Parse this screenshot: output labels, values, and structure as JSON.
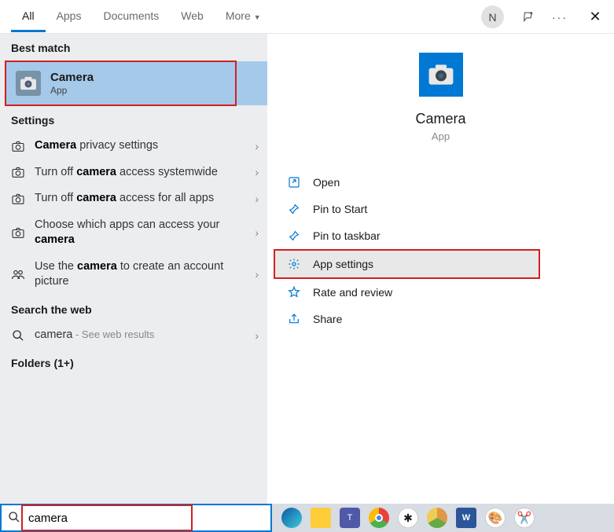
{
  "header": {
    "tabs": [
      "All",
      "Apps",
      "Documents",
      "Web",
      "More"
    ],
    "avatar_initial": "N"
  },
  "left": {
    "section_best": "Best match",
    "best_match": {
      "title": "Camera",
      "subtitle": "App"
    },
    "section_settings": "Settings",
    "settings_items": [
      {
        "bold1": "Camera",
        "rest": " privacy settings"
      },
      {
        "pre": "Turn off ",
        "bold": "camera",
        "post": " access systemwide"
      },
      {
        "pre": "Turn off ",
        "bold": "camera",
        "post": " access for all apps"
      },
      {
        "pre": "Choose which apps can access your ",
        "bold": "camera",
        "post": ""
      },
      {
        "pre": "Use the ",
        "bold": "camera",
        "post": " to create an account picture"
      }
    ],
    "section_web": "Search the web",
    "web_item": {
      "term": "camera",
      "suffix": " - See web results"
    },
    "section_folders": "Folders (1+)"
  },
  "right": {
    "title": "Camera",
    "subtitle": "App",
    "actions": [
      {
        "label": "Open",
        "icon": "open"
      },
      {
        "label": "Pin to Start",
        "icon": "pin-start"
      },
      {
        "label": "Pin to taskbar",
        "icon": "pin-tb"
      },
      {
        "label": "App settings",
        "icon": "gear",
        "selected": true,
        "hl": true
      },
      {
        "label": "Rate and review",
        "icon": "star"
      },
      {
        "label": "Share",
        "icon": "share"
      }
    ]
  },
  "search": {
    "value": "camera"
  }
}
